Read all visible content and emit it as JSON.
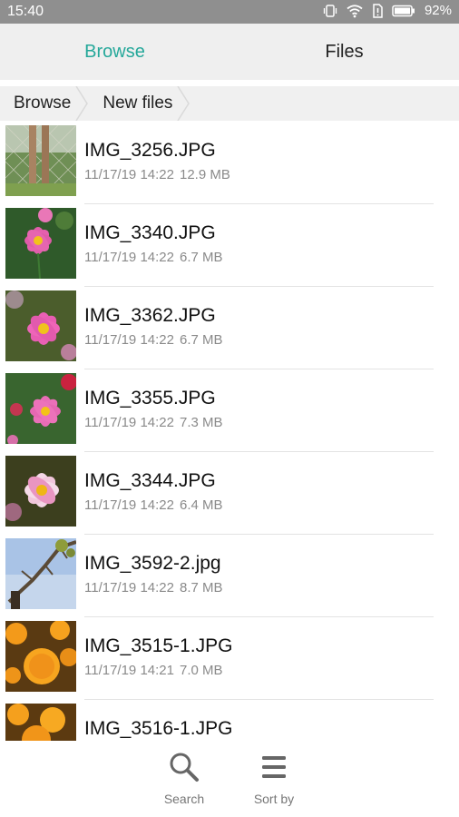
{
  "status_bar": {
    "time": "15:40",
    "battery_percent": "92%"
  },
  "tabs": [
    {
      "label": "Browse",
      "active": true
    },
    {
      "label": "Files",
      "active": false
    }
  ],
  "breadcrumb": [
    "Browse",
    "New files"
  ],
  "files": [
    {
      "name": "IMG_3256.JPG",
      "date": "11/17/19 14:22",
      "size": "12.9 MB",
      "thumb": "fence-legs"
    },
    {
      "name": "IMG_3340.JPG",
      "date": "11/17/19 14:22",
      "size": "6.7 MB",
      "thumb": "pink-cosmos"
    },
    {
      "name": "IMG_3362.JPG",
      "date": "11/17/19 14:22",
      "size": "6.7 MB",
      "thumb": "pink-cosmos"
    },
    {
      "name": "IMG_3355.JPG",
      "date": "11/17/19 14:22",
      "size": "7.3 MB",
      "thumb": "pink-cosmos"
    },
    {
      "name": "IMG_3344.JPG",
      "date": "11/17/19 14:22",
      "size": "6.4 MB",
      "thumb": "white-cosmos"
    },
    {
      "name": "IMG_3592-2.jpg",
      "date": "11/17/19 14:22",
      "size": "8.7 MB",
      "thumb": "sky-branch"
    },
    {
      "name": "IMG_3515-1.JPG",
      "date": "11/17/19 14:21",
      "size": "7.0 MB",
      "thumb": "orange-marigold"
    },
    {
      "name": "IMG_3516-1.JPG",
      "date": "",
      "size": "",
      "thumb": "orange-marigold"
    }
  ],
  "bottom_bar": {
    "search_label": "Search",
    "sort_label": "Sort by"
  },
  "colors": {
    "accent": "#25a89a",
    "status_bar": "#8f8f8f",
    "tab_bar": "#efefef"
  }
}
